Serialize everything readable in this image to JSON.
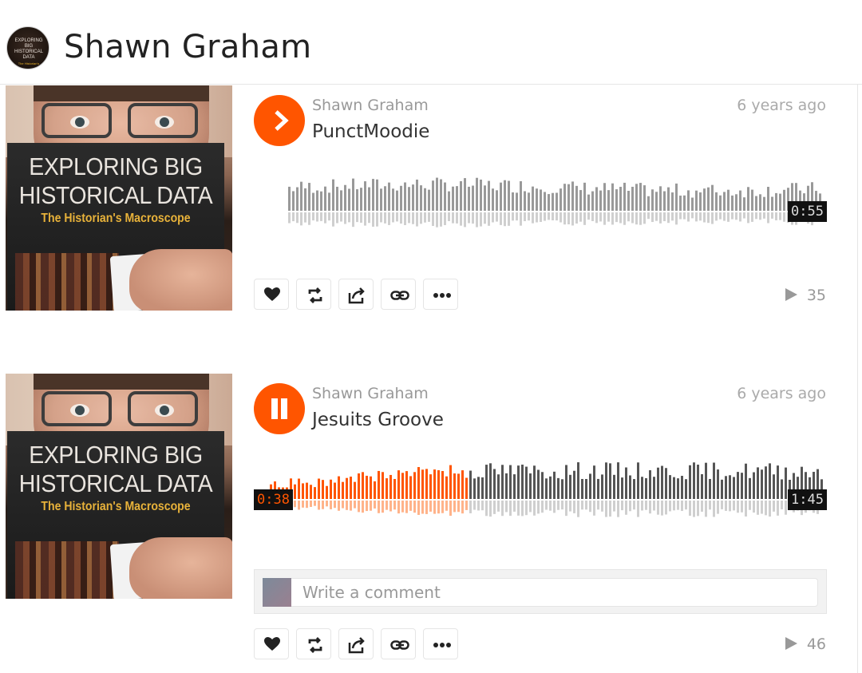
{
  "header": {
    "user_name": "Shawn Graham"
  },
  "tracks": [
    {
      "user": "Shawn Graham",
      "title": "PunctMoodie",
      "posted": "6 years ago",
      "duration": "0:55",
      "current_time": "",
      "playing": false,
      "progress": 0,
      "plays": "35",
      "has_comment_box": false
    },
    {
      "user": "Shawn Graham",
      "title": "Jesuits Groove",
      "posted": "6 years ago",
      "duration": "1:45",
      "current_time": "0:38",
      "playing": true,
      "progress": 0.36,
      "plays": "46",
      "has_comment_box": true
    }
  ],
  "artwork": {
    "cover_title": "EXPLORING BIG HISTORICAL DATA",
    "cover_title_line1": "EXPLORING BIG",
    "cover_title_line2": "HISTORICAL DATA",
    "cover_subtitle": "The Historian's Macroscope"
  },
  "comment": {
    "placeholder": "Write a comment"
  },
  "icons": {
    "like": "heart-icon",
    "repost": "repost-icon",
    "share": "share-icon",
    "copy_link": "link-icon",
    "more": "more-icon",
    "play": "play-icon",
    "pause": "pause-icon"
  },
  "colors": {
    "accent": "#ff5500",
    "wave_played": "#ff5500",
    "wave_unplayed": "#999999"
  }
}
